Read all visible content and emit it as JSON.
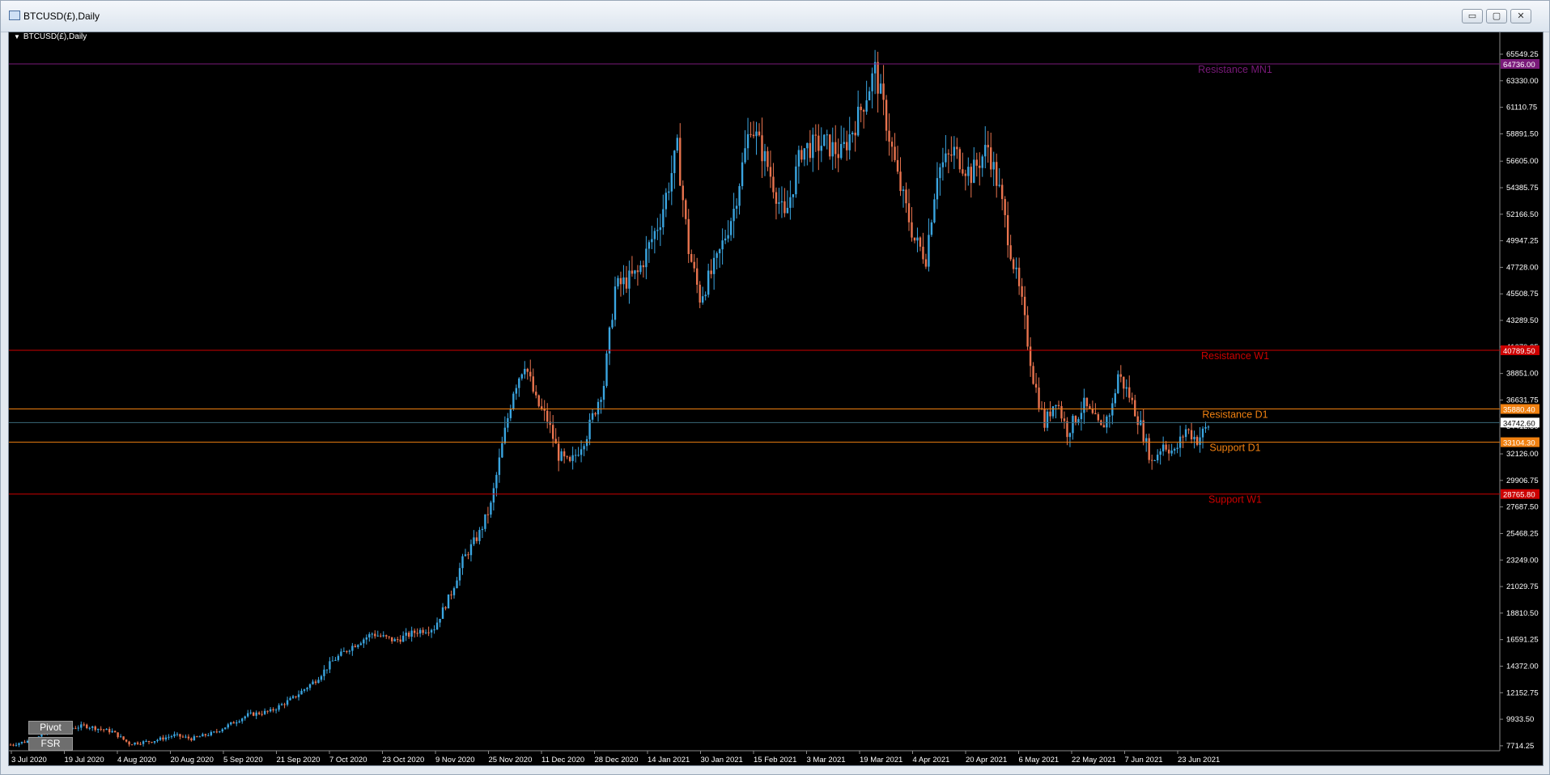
{
  "window": {
    "title": "BTCUSD(£),Daily",
    "buttons": {
      "minimize": "▭",
      "maximize": "▢",
      "close": "✕"
    }
  },
  "chart_header": {
    "symbol_label": "BTCUSD(£),Daily"
  },
  "buttons": {
    "pivot": "Pivot",
    "fsr": "FSR"
  },
  "colors": {
    "background": "#000000",
    "bull": "#3aa5e0",
    "bear": "#e8734e",
    "resistance_mn1": "#7a1a7a",
    "resistance_w1": "#cc0000",
    "resistance_d1": "#f08010",
    "support_d1": "#f08010",
    "support_w1": "#cc0000",
    "current_price": "#3a6a7a"
  },
  "chart_data": {
    "type": "candlestick",
    "title": "",
    "y_ticks": [
      "65549.25",
      "63330.00",
      "61110.75",
      "58891.50",
      "56605.00",
      "54385.75",
      "52166.50",
      "49947.25",
      "47728.00",
      "45508.75",
      "43289.50",
      "41070.25",
      "38851.00",
      "36631.75",
      "34412.50",
      "32126.00",
      "29906.75",
      "27687.50",
      "25468.25",
      "23249.00",
      "21029.75",
      "18810.50",
      "16591.25",
      "14372.00",
      "12152.75",
      "9933.50",
      "7714.25"
    ],
    "y_range": [
      7300,
      66700
    ],
    "x_ticks": [
      "3 Jul 2020",
      "19 Jul 2020",
      "4 Aug 2020",
      "20 Aug 2020",
      "5 Sep 2020",
      "21 Sep 2020",
      "7 Oct 2020",
      "23 Oct 2020",
      "9 Nov 2020",
      "25 Nov 2020",
      "11 Dec 2020",
      "28 Dec 2020",
      "14 Jan 2021",
      "30 Jan 2021",
      "15 Feb 2021",
      "3 Mar 2021",
      "19 Mar 2021",
      "4 Apr 2021",
      "20 Apr 2021",
      "6 May 2021",
      "22 May 2021",
      "7 Jun 2021",
      "23 Jun 2021"
    ],
    "levels": [
      {
        "name": "Resistance MN1",
        "value": 64736.0,
        "label": "64736.00",
        "color": "#7a1a7a"
      },
      {
        "name": "Resistance W1",
        "value": 40789.5,
        "label": "40789.50",
        "color": "#cc0000"
      },
      {
        "name": "Resistance D1",
        "value": 35880.4,
        "label": "35880.40",
        "color": "#f08010"
      },
      {
        "name": "Support D1",
        "value": 33104.3,
        "label": "33104.30",
        "color": "#f08010"
      },
      {
        "name": "Support W1",
        "value": 28765.8,
        "label": "28765.80",
        "color": "#cc0000"
      }
    ],
    "current_price": {
      "value": 34742.6,
      "label": "34742.60"
    },
    "price_anchors": [
      [
        0,
        7800
      ],
      [
        8,
        8200
      ],
      [
        14,
        8900
      ],
      [
        20,
        9100
      ],
      [
        26,
        9400
      ],
      [
        30,
        9200
      ],
      [
        36,
        8900
      ],
      [
        42,
        7900
      ],
      [
        50,
        8100
      ],
      [
        58,
        8600
      ],
      [
        64,
        8300
      ],
      [
        72,
        8800
      ],
      [
        80,
        9800
      ],
      [
        84,
        10300
      ],
      [
        92,
        10600
      ],
      [
        100,
        11700
      ],
      [
        108,
        13200
      ],
      [
        114,
        14800
      ],
      [
        120,
        15900
      ],
      [
        128,
        17100
      ],
      [
        136,
        16500
      ],
      [
        144,
        17300
      ],
      [
        150,
        17600
      ],
      [
        156,
        20500
      ],
      [
        160,
        23200
      ],
      [
        166,
        25500
      ],
      [
        170,
        27800
      ],
      [
        174,
        32800
      ],
      [
        178,
        37500
      ],
      [
        182,
        39800
      ],
      [
        186,
        36500
      ],
      [
        190,
        35000
      ],
      [
        194,
        32000
      ],
      [
        198,
        31200
      ],
      [
        204,
        33800
      ],
      [
        210,
        38000
      ],
      [
        214,
        46000
      ],
      [
        222,
        47200
      ],
      [
        230,
        51800
      ],
      [
        236,
        57600
      ],
      [
        240,
        49200
      ],
      [
        244,
        45200
      ],
      [
        250,
        48200
      ],
      [
        256,
        52600
      ],
      [
        262,
        59800
      ],
      [
        268,
        56200
      ],
      [
        274,
        51700
      ],
      [
        280,
        57600
      ],
      [
        288,
        58100
      ],
      [
        294,
        57200
      ],
      [
        300,
        60300
      ],
      [
        306,
        64200
      ],
      [
        310,
        59900
      ],
      [
        314,
        55200
      ],
      [
        320,
        50000
      ],
      [
        324,
        48600
      ],
      [
        328,
        55800
      ],
      [
        334,
        57400
      ],
      [
        340,
        55500
      ],
      [
        346,
        57800
      ],
      [
        350,
        54100
      ],
      [
        354,
        49200
      ],
      [
        358,
        44600
      ],
      [
        362,
        38500
      ],
      [
        366,
        34600
      ],
      [
        370,
        36800
      ],
      [
        374,
        34000
      ],
      [
        380,
        36200
      ],
      [
        386,
        34200
      ],
      [
        390,
        36100
      ],
      [
        392,
        38800
      ],
      [
        396,
        37000
      ],
      [
        400,
        34500
      ],
      [
        404,
        31400
      ],
      [
        408,
        33000
      ],
      [
        412,
        32200
      ],
      [
        416,
        34200
      ],
      [
        420,
        33300
      ],
      [
        424,
        34500
      ]
    ]
  }
}
